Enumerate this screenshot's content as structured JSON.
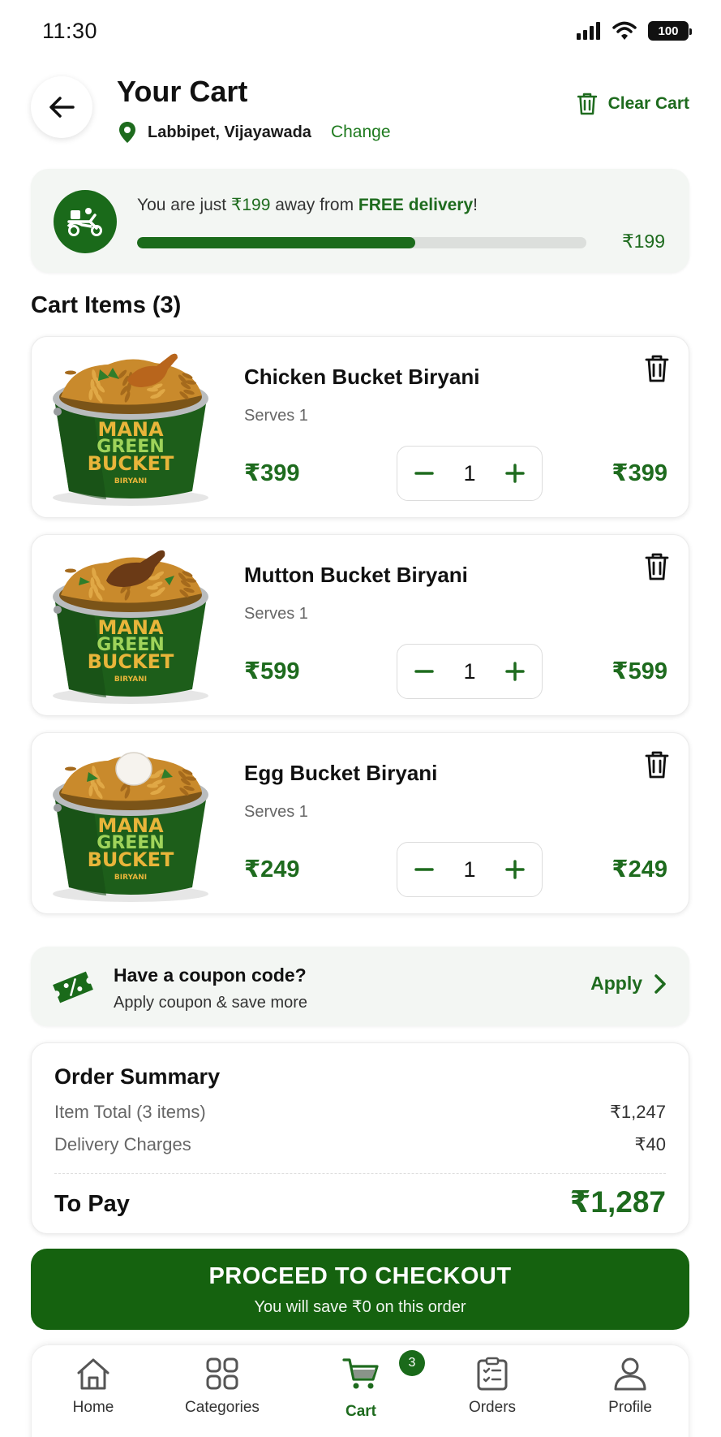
{
  "status_bar": {
    "time": "11:30",
    "battery": "100"
  },
  "header": {
    "title": "Your Cart",
    "location": "Labbipet, Vijayawada",
    "change_label": "Change",
    "clear_cart_label": "Clear Cart"
  },
  "delivery_banner": {
    "text_prefix": "You are just ",
    "amount_inline": "₹199",
    "text_middle": " away from ",
    "highlight": "FREE delivery",
    "text_suffix": "!",
    "remaining_amount": "₹199",
    "progress_fraction": 0.62
  },
  "cart": {
    "section_title": "Cart Items (3)",
    "items": [
      {
        "name": "Chicken Bucket Biryani",
        "serves": "Serves 1",
        "price": "₹399",
        "qty": "1",
        "total": "₹399",
        "topping": "chicken"
      },
      {
        "name": "Mutton Bucket Biryani",
        "serves": "Serves 1",
        "price": "₹599",
        "qty": "1",
        "total": "₹599",
        "topping": "mutton"
      },
      {
        "name": "Egg Bucket Biryani",
        "serves": "Serves 1",
        "price": "₹249",
        "qty": "1",
        "total": "₹249",
        "topping": "egg"
      }
    ],
    "bucket_brand": [
      "MANA",
      "GREEN",
      "BUCKET",
      "BIRYANI"
    ]
  },
  "coupon": {
    "title": "Have a coupon code?",
    "subtitle": "Apply coupon & save more",
    "apply_label": "Apply"
  },
  "summary": {
    "title": "Order Summary",
    "item_total_label": "Item Total (3 items)",
    "item_total_value": "₹1,247",
    "delivery_label": "Delivery Charges",
    "delivery_value": "₹40",
    "to_pay_label": "To Pay",
    "to_pay_value": "₹1,287"
  },
  "checkout": {
    "label": "PROCEED TO CHECKOUT",
    "subtext": "You will save ₹0 on this order"
  },
  "bottom_nav": {
    "items": [
      {
        "label": "Home",
        "icon": "home-icon"
      },
      {
        "label": "Categories",
        "icon": "grid-icon"
      },
      {
        "label": "Cart",
        "icon": "cart-icon",
        "active": true,
        "badge": "3"
      },
      {
        "label": "Orders",
        "icon": "clipboard-icon"
      },
      {
        "label": "Profile",
        "icon": "user-icon"
      }
    ]
  },
  "colors": {
    "primary": "#1e6b1e",
    "primary_dark": "#15620f",
    "banner_bg": "#f3f6f3"
  }
}
